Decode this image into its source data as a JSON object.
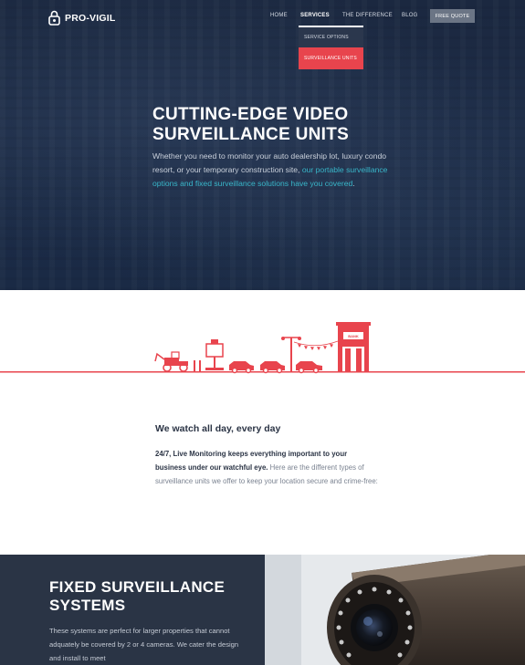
{
  "brand": {
    "name": "PRO-VIGIL",
    "logo_icon": "lock-shield-icon"
  },
  "nav": {
    "items": [
      {
        "label": "HOME",
        "active": false
      },
      {
        "label": "SERVICES",
        "active": true
      },
      {
        "label": "THE DIFFERENCE",
        "active": false
      },
      {
        "label": "BLOG",
        "active": false
      }
    ],
    "cta": "FREE QUOTE"
  },
  "dropdown": {
    "items": [
      {
        "label": "SERVICE OPTIONS",
        "highlighted": false
      },
      {
        "label": "SURVEILLANCE UNITS",
        "highlighted": true
      }
    ]
  },
  "hero": {
    "title_line1": "CUTTING-EDGE VIDEO",
    "title_line2": "SURVEILLANCE UNITS",
    "body_plain": "Whether you need to monitor your auto dealership lot, luxury condo resort, or your temporary construction site, ",
    "body_link": "our portable surveillance options and fixed surveillance solutions have you covered",
    "body_end": "."
  },
  "illustration": {
    "sign_text": "BANK",
    "icon": "city-scene-illustration"
  },
  "watch": {
    "title": "We watch all day, every day",
    "body_bold": "24/7, Live Monitoring keeps everything important to your business under our watchful eye.",
    "body_rest": " Here are the different types of surveillance units we offer to keep your location secure and crime-free:"
  },
  "fixed": {
    "title_line1": "FIXED SURVEILLANCE",
    "title_line2": "SYSTEMS",
    "body": "These systems are perfect for larger properties that cannot adquately be covered by 2 or 4 cameras. We cater the design and install to meet"
  },
  "colors": {
    "hero_bg": "#1b2840",
    "accent_red": "#e8444d",
    "link_teal": "#38b6c9",
    "dark_panel": "#2a3445",
    "quote_btn": "#6b7585"
  }
}
